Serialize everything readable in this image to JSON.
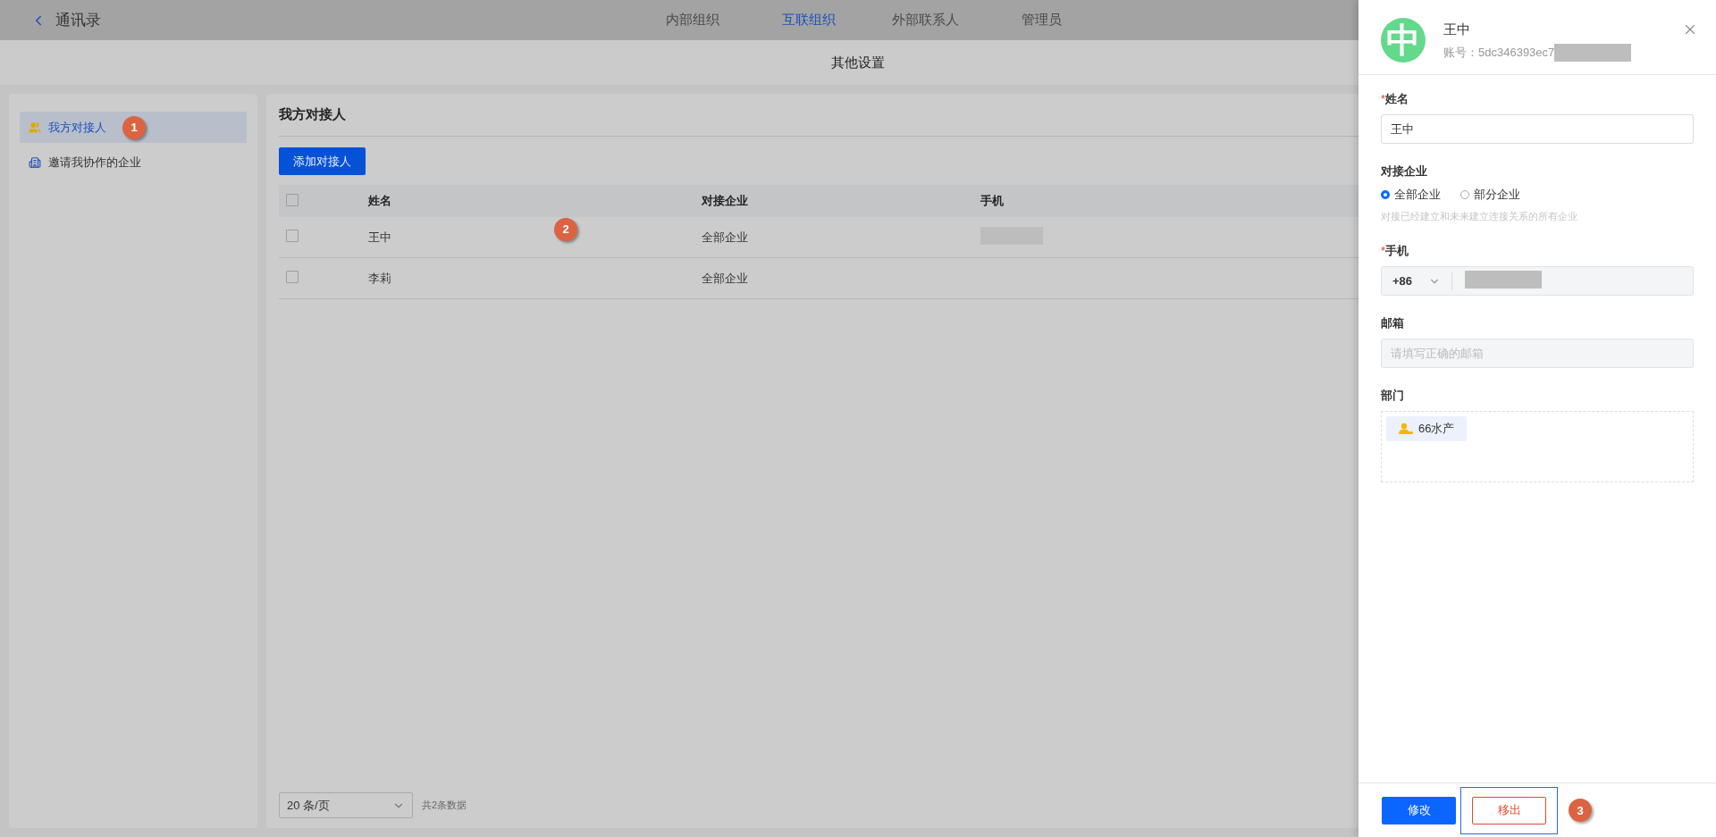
{
  "header": {
    "back_label": "通讯录",
    "tabs": [
      {
        "label": "内部组织",
        "selected": false
      },
      {
        "label": "互联组织",
        "selected": true
      },
      {
        "label": "外部联系人",
        "selected": false
      },
      {
        "label": "管理员",
        "selected": false
      }
    ]
  },
  "subheader": {
    "title": "其他设置"
  },
  "sidebar": {
    "items": [
      {
        "label": "我方对接人",
        "selected": true,
        "kind": "people",
        "annotation": "1"
      },
      {
        "label": "邀请我协作的企业",
        "selected": false,
        "kind": "building"
      }
    ]
  },
  "main": {
    "title": "我方对接人",
    "add_button": "添加对接人",
    "table": {
      "select_all_checked": false,
      "columns": [
        "姓名",
        "对接企业",
        "手机"
      ],
      "rows": [
        {
          "checked": false,
          "cells": [
            "王中",
            "全部企业"
          ],
          "phone_redacted": true,
          "annotation": "2"
        },
        {
          "checked": false,
          "cells": [
            "李莉",
            "全部企业"
          ],
          "phone_redacted": false
        }
      ]
    },
    "pagination": {
      "page_size": "20 条/页",
      "total": "共2条数据"
    }
  },
  "drawer": {
    "avatar": "中",
    "name": "王中",
    "account": "账号：5dc346393ec7",
    "account_redacted": true,
    "fields": [
      {
        "kind": "text",
        "label": "姓名",
        "required_mark": "*",
        "value": "王中"
      },
      {
        "kind": "radio",
        "label": "对接企业",
        "options": [
          {
            "label": "全部企业",
            "selected": true
          },
          {
            "label": "部分企业",
            "selected": false
          }
        ],
        "hint": "对接已经建立和未来建立连接关系的所有企业"
      },
      {
        "kind": "phone",
        "label": "手机",
        "required_mark": "*",
        "country": "+86",
        "redacted": true
      },
      {
        "kind": "email",
        "label": "邮箱",
        "placeholder": "请填写正确的邮箱"
      },
      {
        "kind": "tags",
        "label": "部门",
        "tags": [
          {
            "label": "66水产"
          }
        ]
      }
    ],
    "buttons": [
      {
        "label": "修改",
        "kind": "primary",
        "highlighted": false
      },
      {
        "label": "移出",
        "kind": "danger",
        "highlighted": true,
        "annotation": "3"
      }
    ]
  }
}
